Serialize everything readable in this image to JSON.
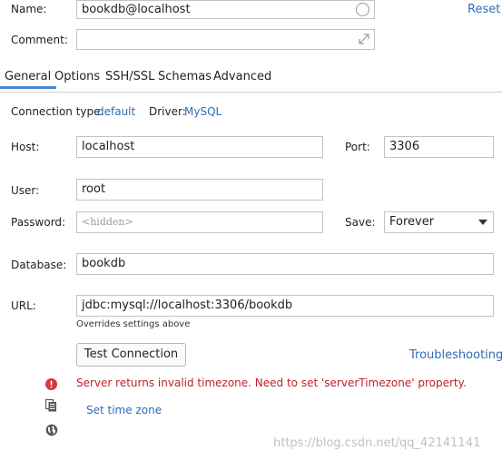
{
  "header": {
    "name_label": "Name:",
    "name_value": "bookdb@localhost",
    "reset_link": "Reset",
    "comment_label": "Comment:",
    "comment_value": ""
  },
  "tabs": [
    {
      "label": "General",
      "active": true
    },
    {
      "label": "Options",
      "active": false
    },
    {
      "label": "SSH/SSL",
      "active": false
    },
    {
      "label": "Schemas",
      "active": false
    },
    {
      "label": "Advanced",
      "active": false
    }
  ],
  "general": {
    "connection_type_label": "Connection type:",
    "connection_type_value": "default",
    "driver_label": "Driver:",
    "driver_value": "MySQL",
    "host_label": "Host:",
    "host_value": "localhost",
    "port_label": "Port:",
    "port_value": "3306",
    "user_label": "User:",
    "user_value": "root",
    "password_label": "Password:",
    "password_placeholder": "<hidden>",
    "save_label": "Save:",
    "save_value": "Forever",
    "database_label": "Database:",
    "database_value": "bookdb",
    "url_label": "URL:",
    "url_value": "jdbc:mysql://localhost:3306/bookdb",
    "url_hint": "Overrides settings above",
    "test_connection_button": "Test Connection",
    "troubleshooting_link": "Troubleshooting",
    "error_message": "Server returns invalid timezone. Need to set 'serverTimezone' property.",
    "set_time_zone_link": "Set time zone"
  },
  "watermark": "https://blog.csdn.net/qq_42141141",
  "colors": {
    "link": "#2d6db5",
    "error": "#c0202a",
    "tab_active_underline": "#4a8ad4"
  }
}
